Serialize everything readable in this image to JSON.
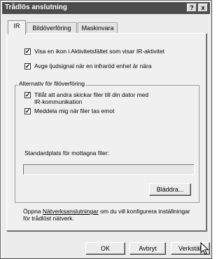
{
  "window": {
    "title": "Trådlös anslutning",
    "help_label": "?",
    "close_label": "x"
  },
  "tabs": [
    {
      "label": "IR",
      "active": true
    },
    {
      "label": "Bildöverföring",
      "active": false
    },
    {
      "label": "Maskinvara",
      "active": false
    }
  ],
  "options": {
    "show_icon": {
      "label": "Visa en ikon i Aktivitetsfältet som visar IR-aktivitet",
      "checked": true
    },
    "sound_signal": {
      "label": "Avge ljudsignal när en infraröd enhet är nära",
      "checked": true
    }
  },
  "file_transfer": {
    "group_title": "Alternativ för filöverföring",
    "allow_send": {
      "label_line1": "Tillåt att andra skickar filer till din dator med",
      "label_line2": "IR-kommunikation",
      "checked": true
    },
    "notify": {
      "label": "Meddela mig när filer tas emot",
      "checked": true
    },
    "location_label": "Standardplats för mottagna filer:",
    "location_value": "",
    "browse_label": "Bläddra..."
  },
  "footer": {
    "text_before": "Öppna ",
    "link_text": "Nätverksanslutningar",
    "text_after": " om du vill konfigurera inställningar",
    "text_line2": "för trådlöst nätverk."
  },
  "buttons": {
    "ok": "OK",
    "cancel": "Avbryt",
    "apply": "Verkställ"
  },
  "check_glyph": "✓"
}
